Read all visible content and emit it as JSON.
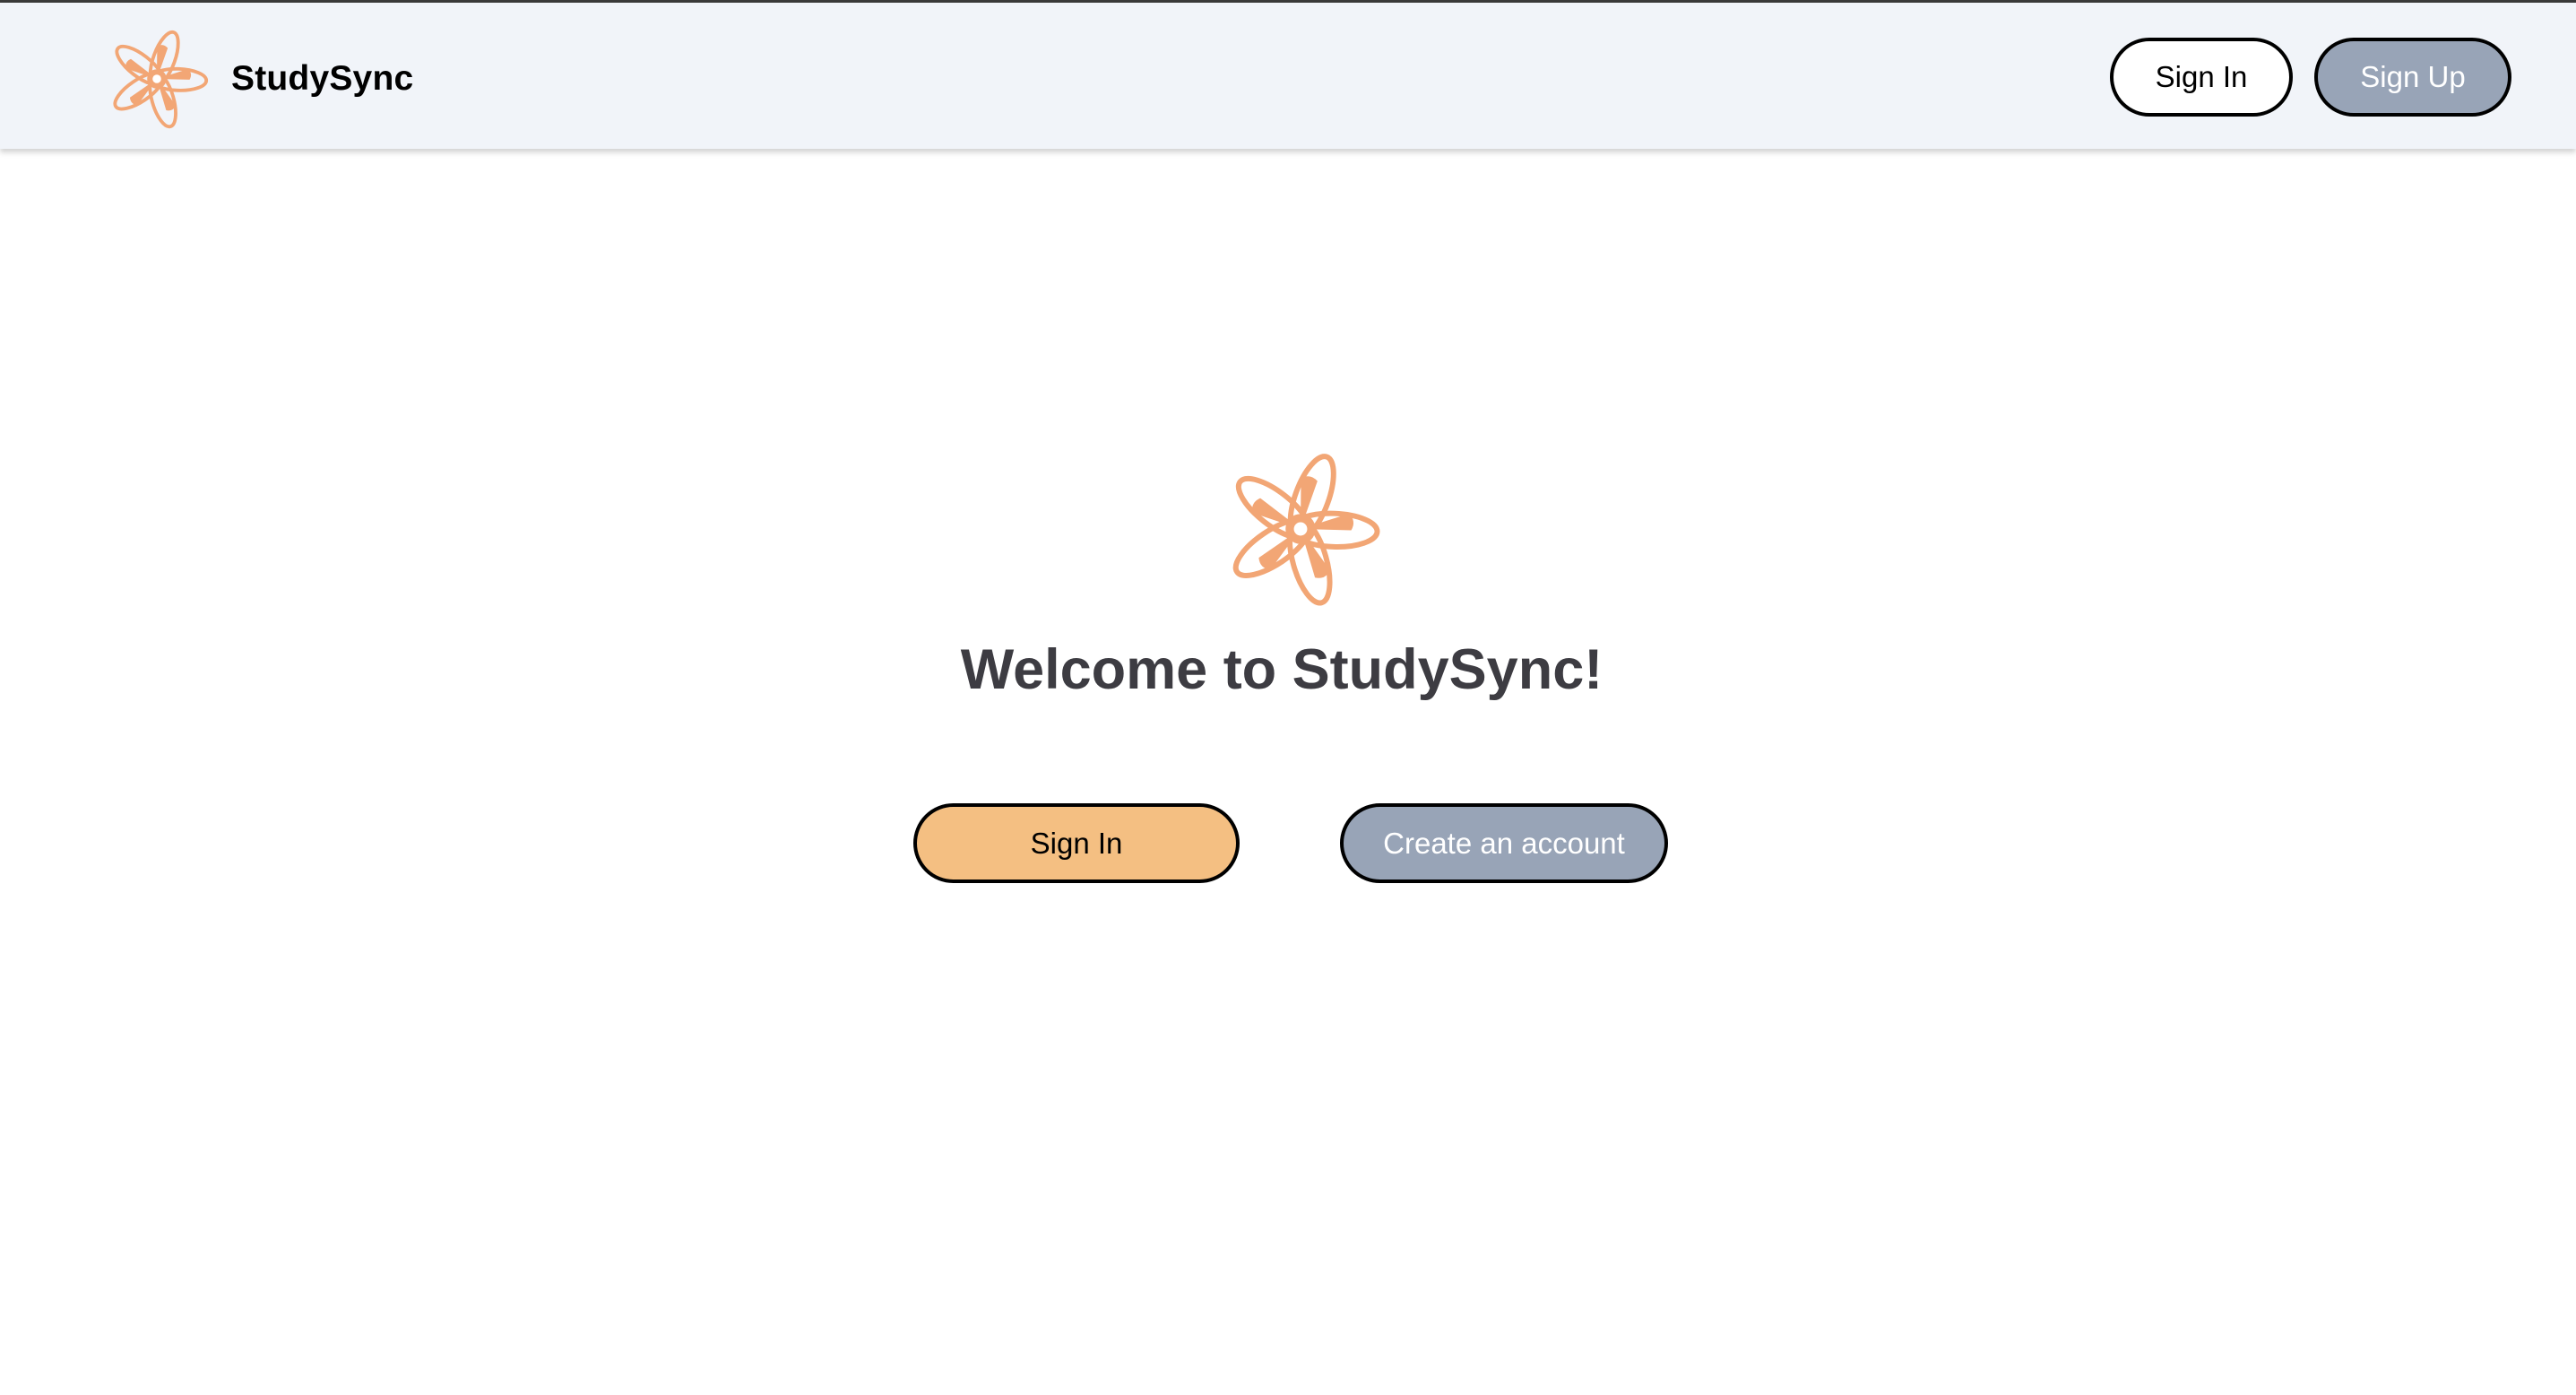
{
  "app": {
    "name": "StudySync",
    "logo_icon": "flower-orbit-logo-icon",
    "colors": {
      "accent": "#f4bf82",
      "logo": "#f2a675",
      "secondary": "#98a4b7",
      "navbar_bg": "#f1f4f9",
      "title_text": "#3d3c42"
    }
  },
  "navbar": {
    "sign_in_label": "Sign In",
    "sign_up_label": "Sign Up"
  },
  "hero": {
    "title": "Welcome to StudySync!",
    "sign_in_label": "Sign In",
    "create_account_label": "Create an account"
  }
}
